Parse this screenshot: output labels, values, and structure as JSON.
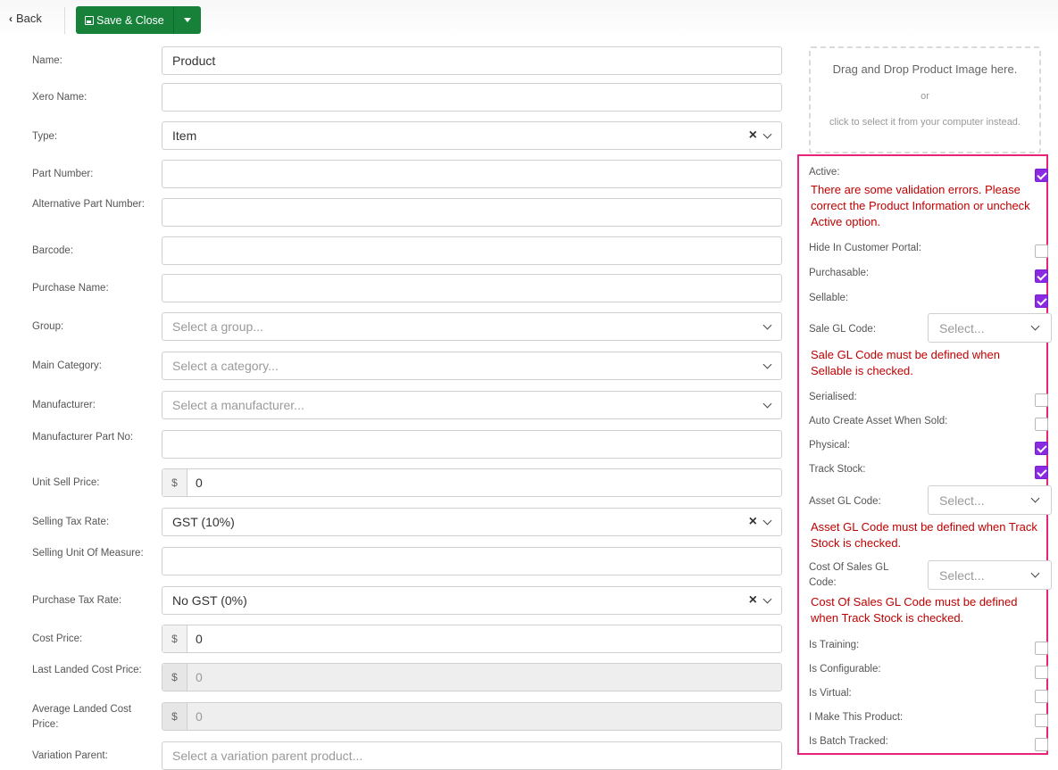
{
  "toolbar": {
    "back_label": "Back",
    "save_label": "Save & Close"
  },
  "form": {
    "name": {
      "label": "Name:",
      "value": "Product"
    },
    "xero_name": {
      "label": "Xero Name:",
      "value": ""
    },
    "type": {
      "label": "Type:",
      "value": "Item"
    },
    "part_number": {
      "label": "Part Number:",
      "value": ""
    },
    "alt_part_number": {
      "label": "Alternative Part Number:",
      "value": ""
    },
    "barcode": {
      "label": "Barcode:",
      "value": ""
    },
    "purchase_name": {
      "label": "Purchase Name:",
      "value": ""
    },
    "group": {
      "label": "Group:",
      "placeholder": "Select a group..."
    },
    "main_category": {
      "label": "Main Category:",
      "placeholder": "Select a category..."
    },
    "manufacturer": {
      "label": "Manufacturer:",
      "placeholder": "Select a manufacturer..."
    },
    "manufacturer_part_no": {
      "label": "Manufacturer Part No:",
      "value": ""
    },
    "unit_sell_price": {
      "label": "Unit Sell Price:",
      "currency": "$",
      "value": "0"
    },
    "selling_tax_rate": {
      "label": "Selling Tax Rate:",
      "value": "GST (10%)"
    },
    "selling_unit_of_measure": {
      "label": "Selling Unit Of Measure:",
      "value": ""
    },
    "purchase_tax_rate": {
      "label": "Purchase Tax Rate:",
      "value": "No GST (0%)"
    },
    "cost_price": {
      "label": "Cost Price:",
      "currency": "$",
      "value": "0"
    },
    "last_landed_cost_price": {
      "label": "Last Landed Cost Price:",
      "currency": "$",
      "value": "0"
    },
    "average_landed_cost_price": {
      "label": "Average Landed Cost Price:",
      "currency": "$",
      "value": "0"
    },
    "variation_parent": {
      "label": "Variation Parent:",
      "placeholder": "Select a variation parent product..."
    }
  },
  "image_dropzone": {
    "main": "Drag and Drop Product Image here.",
    "or": "or",
    "sub": "click to select it from your computer instead."
  },
  "panel": {
    "active": {
      "label": "Active:",
      "checked": true
    },
    "active_error": "There are some validation errors. Please correct the Product Information or uncheck Active option.",
    "hide_portal": {
      "label": "Hide In Customer Portal:",
      "checked": false
    },
    "purchasable": {
      "label": "Purchasable:",
      "checked": true
    },
    "sellable": {
      "label": "Sellable:",
      "checked": true
    },
    "sale_gl_code": {
      "label": "Sale GL Code:",
      "placeholder": "Select..."
    },
    "sale_gl_error": "Sale GL Code must be defined when Sellable is checked.",
    "serialised": {
      "label": "Serialised:",
      "checked": false
    },
    "auto_create_asset": {
      "label": "Auto Create Asset When Sold:",
      "checked": false
    },
    "physical": {
      "label": "Physical:",
      "checked": true
    },
    "track_stock": {
      "label": "Track Stock:",
      "checked": true
    },
    "asset_gl_code": {
      "label": "Asset GL Code:",
      "placeholder": "Select..."
    },
    "asset_gl_error": "Asset GL Code must be defined when Track Stock is checked.",
    "cost_of_sales_gl_code": {
      "label": "Cost Of Sales GL Code:",
      "placeholder": "Select..."
    },
    "cost_of_sales_error": "Cost Of Sales GL Code must be defined when Track Stock is checked.",
    "is_training": {
      "label": "Is Training:",
      "checked": false
    },
    "is_configurable": {
      "label": "Is Configurable:",
      "checked": false
    },
    "is_virtual": {
      "label": "Is Virtual:",
      "checked": false
    },
    "i_make_this": {
      "label": "I Make This Product:",
      "checked": false
    },
    "is_batch_tracked": {
      "label": "Is Batch Tracked:",
      "checked": false
    }
  },
  "colors": {
    "save_green": "#17813a",
    "checkbox_purple": "#8a2be2",
    "panel_border": "#e8237c",
    "error_red": "#c00000"
  }
}
